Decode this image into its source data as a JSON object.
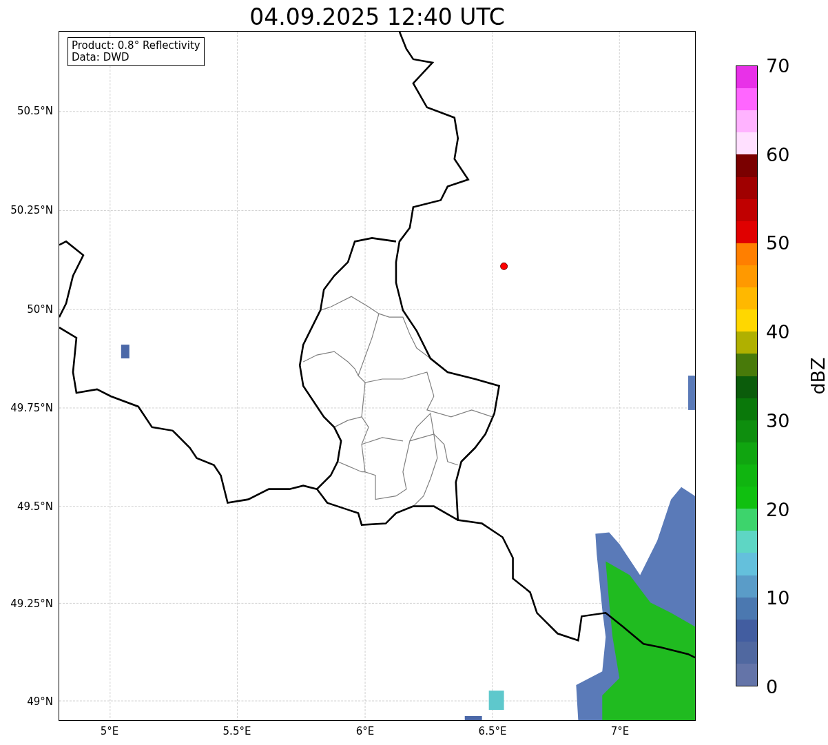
{
  "title": "04.09.2025 12:40 UTC",
  "info_box": [
    "Product: 0.8° Reflectivity",
    "Data: DWD"
  ],
  "y_ticks": [
    "50.5°N",
    "50.25°N",
    "50°N",
    "49.75°N",
    "49.5°N",
    "49.25°N",
    "49°N"
  ],
  "x_ticks": [
    "5°E",
    "5.5°E",
    "6°E",
    "6.5°E",
    "7°E"
  ],
  "colorbar": {
    "label": "dBZ",
    "ticks": [
      "70",
      "60",
      "50",
      "40",
      "30",
      "20",
      "10",
      "0"
    ],
    "levels": [
      {
        "color": "#6474a8"
      },
      {
        "color": "#5068a0"
      },
      {
        "color": "#425da0"
      },
      {
        "color": "#4b78b0"
      },
      {
        "color": "#5a9cc8"
      },
      {
        "color": "#64c0dc"
      },
      {
        "color": "#5ed6c4"
      },
      {
        "color": "#3dd46c"
      },
      {
        "color": "#10c010"
      },
      {
        "color": "#10b510"
      },
      {
        "color": "#10a510"
      },
      {
        "color": "#0e8e0e"
      },
      {
        "color": "#0a780a"
      },
      {
        "color": "#0b5c0b"
      },
      {
        "color": "#487a0a"
      },
      {
        "color": "#b0b000"
      },
      {
        "color": "#ffd700"
      },
      {
        "color": "#ffb800"
      },
      {
        "color": "#ff9900"
      },
      {
        "color": "#ff7f00"
      },
      {
        "color": "#e00000"
      },
      {
        "color": "#c00000"
      },
      {
        "color": "#a00000"
      },
      {
        "color": "#7a0000"
      },
      {
        "color": "#ffe0ff"
      },
      {
        "color": "#ffb3ff"
      },
      {
        "color": "#ff66ff"
      },
      {
        "color": "#e831e8"
      }
    ]
  }
}
